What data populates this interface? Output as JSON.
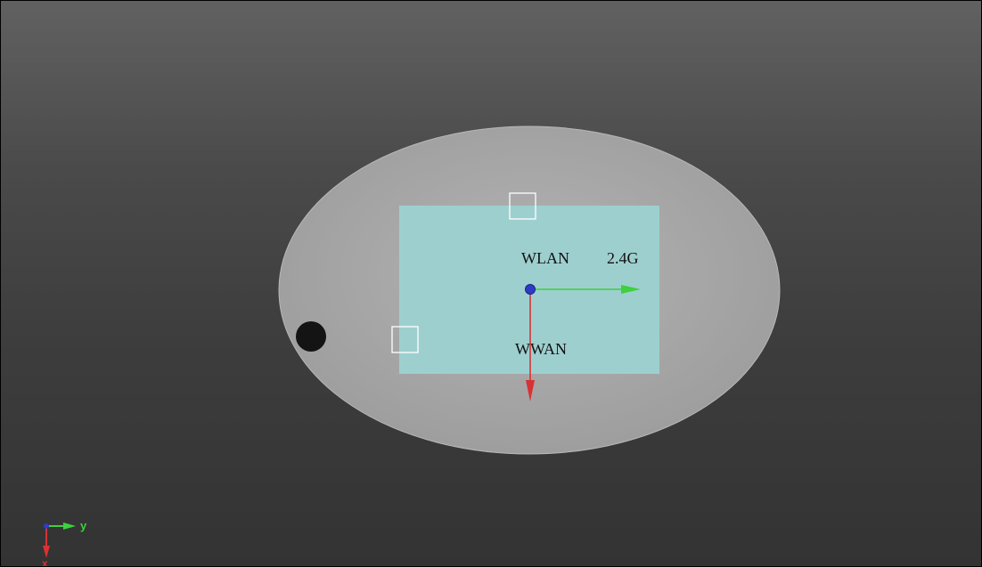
{
  "scene": {
    "labels": {
      "wlan": "WLAN",
      "band": "2.4G",
      "wwan": "WWAN"
    }
  },
  "axis_triad": {
    "y_label": "y",
    "x_label": "x"
  },
  "colors": {
    "background_top": "#616161",
    "background_bottom": "#333333",
    "plate": "#a6a6a6",
    "board": "#9ecfcf",
    "marker": "#ffffff",
    "hole": "#141414",
    "origin_point": "#2c3cc8",
    "y_axis_arrow": "#3dd13d",
    "x_axis_arrow": "#d83232"
  }
}
